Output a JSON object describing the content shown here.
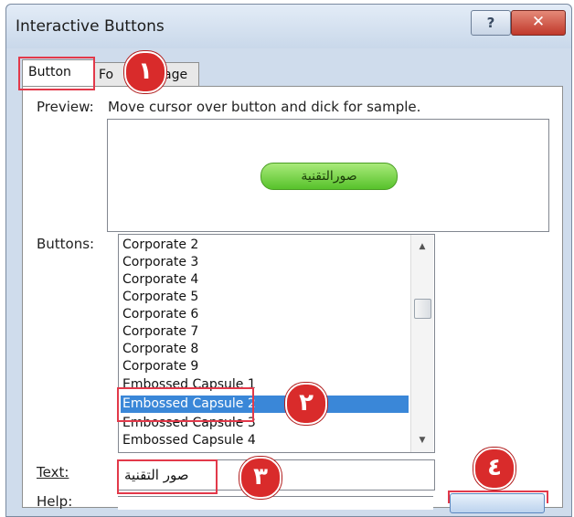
{
  "window": {
    "title": "Interactive Buttons",
    "help_glyph": "?",
    "close_glyph": "✕"
  },
  "tabs": [
    {
      "label": "Button"
    },
    {
      "label": "Fo"
    },
    {
      "label": "age"
    }
  ],
  "preview": {
    "label": "Preview:",
    "instruction": "Move cursor over button and dick for sample.",
    "button_text": "صورالتقنية",
    "button_color": "#6ccf3c"
  },
  "buttons": {
    "label": "Buttons:",
    "items": [
      "Corporate 2",
      "Corporate 3",
      "Corporate 4",
      "Corporate 5",
      "Corporate 6",
      "Corporate 7",
      "Corporate 8",
      "Corporate 9",
      "Embossed Capsule 1",
      "Embossed Capsule 2",
      "Embossed Capsule 3",
      "Embossed Capsule 4"
    ],
    "selected": "Embossed Capsule 2",
    "scroll_up": "▲",
    "scroll_down": "▼"
  },
  "text_field": {
    "label": "Text:",
    "value": "صور التقنية"
  },
  "help_field": {
    "label": "Help:"
  },
  "markers": [
    "١",
    "٢",
    "٣",
    "٤"
  ],
  "colors": {
    "highlight": "#e2394a",
    "marker": "#d92b2b",
    "selection": "#3a87d8"
  }
}
